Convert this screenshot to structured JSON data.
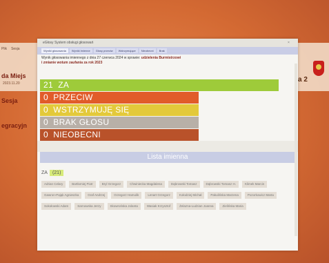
{
  "background_window": {
    "title_lines": [
      "da Miejs",
      "Sesja",
      "egracyjn"
    ],
    "menu": [
      "Plik",
      "Sesja"
    ],
    "date": "2023.11.20",
    "right_text": "a 2"
  },
  "dialog": {
    "title": "eGłosy System obsługi głosowań",
    "close": "×",
    "tabs": [
      "Wyniki głosowania",
      "Wyniki imienne",
      "Głosy przeciw",
      "Wstrzymujące",
      "Nieobecni",
      "Brak"
    ],
    "info_line1": "Wynik głosowania imiennego z dnia 27 czerwca 2024 w sprawie:",
    "info_bold": "udzielenia Burmistrzowi",
    "info_line2": "i zmianie wotum zaufania za rok 2023",
    "votes": [
      {
        "count": "21",
        "label": "ZA"
      },
      {
        "count": "0",
        "label": "PRZECIW"
      },
      {
        "count": "0",
        "label": "WSTRZYMUJĘ SIĘ"
      },
      {
        "count": "0",
        "label": "BRAK GŁOSU"
      },
      {
        "count": "0",
        "label": "NIEOBECNI"
      }
    ],
    "colors": {
      "za": "#9ecb3a",
      "przeciw": "#e15c2a",
      "wstrzymuje": "#e3c93a",
      "brak": "#b8b0a8",
      "nieobecni": "#b9522a"
    },
    "lista_title": "Lista imienna",
    "za_label": "ZA",
    "za_count": "(21)",
    "names": [
      "Adrian Celary",
      "Bartłomiej Piotr",
      "Bryl Grzegorz",
      "Chwiniecka Magdalena",
      "Dąbrowski Tomasz",
      "Dąbrowski Tomasz H.",
      "Klimek Marcin",
      "Gawron-Pająk Agnieszka",
      "Graf Andrzej",
      "Grzegorz Hamulik",
      "Lenart Grzegorz",
      "Kołodziej Michał",
      "Pakulińska Marzena",
      "Pozorkowicz Marta",
      "Sokołowski Adam",
      "Sarnowska Jerzy",
      "Skowrońska Jolanta",
      "Wasiak Krzysztof",
      "Żelazna-Ludzian Joanna",
      "Zielińska Maria"
    ]
  }
}
